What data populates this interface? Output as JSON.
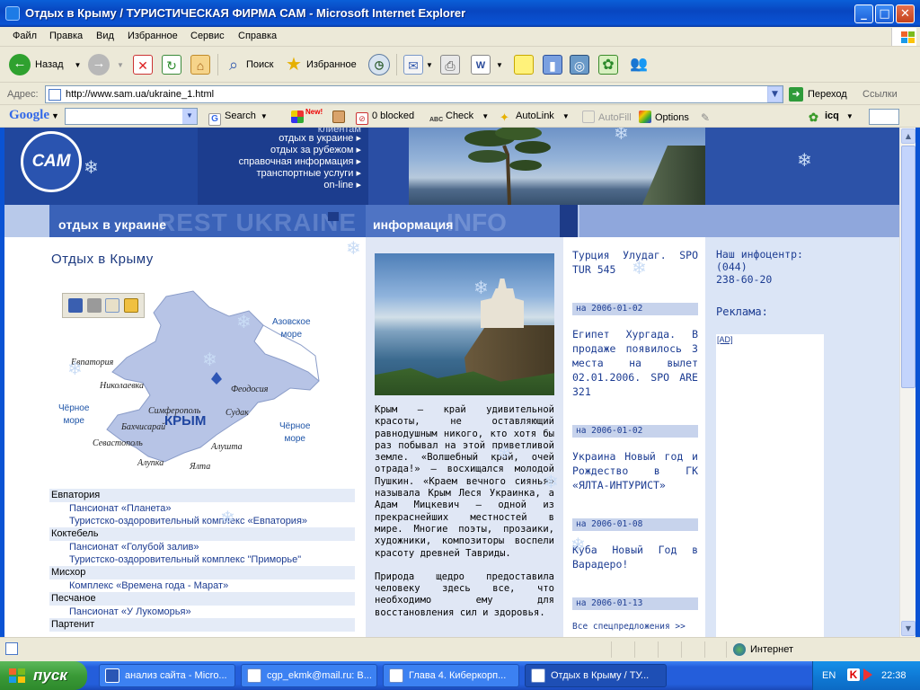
{
  "window": {
    "title": "Отдых в Крыму / ТУРИСТИЧЕСКАЯ ФИРМА САМ - Microsoft Internet Explorer",
    "accent": "#0a53d4"
  },
  "menu": [
    "Файл",
    "Правка",
    "Вид",
    "Избранное",
    "Сервис",
    "Справка"
  ],
  "toolbar": {
    "back_label": "Назад",
    "search_label": "Поиск",
    "favorites_label": "Избранное"
  },
  "address": {
    "label": "Адрес:",
    "url": "http://www.sam.ua/ukraine_1.html",
    "go_label": "Переход",
    "links_label": "Ссылки"
  },
  "google_toolbar": {
    "logo": "Google",
    "search_label": "Search",
    "new_badge": "New!",
    "blocked_label": "0 blocked",
    "check_label": "Check",
    "autolink_label": "AutoLink",
    "autofill_label": "AutoFill",
    "options_label": "Options",
    "icq_label": "icq"
  },
  "site": {
    "logo": "САМ",
    "nav": [
      "клиентам",
      "отдых в украине",
      "отдых за рубежом",
      "справочная информация",
      "транспортные услуги",
      "on-line"
    ],
    "section_left": "отдых в украине",
    "section_left_ghost": "REST UKRAINE",
    "section_mid": "информация",
    "section_mid_ghost": "INFO",
    "page_title": "Отдых в Крыму",
    "map": {
      "region": "КРЫМ",
      "seas": [
        {
          "name": "Азовское\nморе"
        },
        {
          "name": "Чёрное\nморе"
        },
        {
          "name": "Чёрное\nморе"
        }
      ],
      "cities": [
        "Евпатория",
        "Николаевка",
        "Симферополь",
        "Бахчисарай",
        "Севастополь",
        "Алупка",
        "Ялта",
        "Алушта",
        "Судак",
        "Феодосия"
      ]
    },
    "locations": [
      {
        "name": "Евпатория",
        "items": [
          "Пансионат «Планета»",
          "Туристско-оздоровительный комплекс «Евпатория»"
        ]
      },
      {
        "name": "Коктебель",
        "items": [
          "Пансионат «Голубой залив»",
          "Туристско-оздоровительный комплекс \"Приморье\""
        ]
      },
      {
        "name": "Мисхор",
        "items": [
          "Комплекс «Времена года - Марат»"
        ]
      },
      {
        "name": "Песчаное",
        "items": [
          "Пансионат «У Лукоморья»"
        ]
      },
      {
        "name": "Партенит",
        "items": []
      }
    ],
    "info_paragraphs": [
      "Крым – край удивительной красоты, не оставляющий равнодушным никого, кто хотя бы раз побывал на этой приветливой земле. «Волшебный край, очей отрада!» – восхищался молодой Пушкин. «Краем вечного сиянья» называла Крым Леся Украинка, а Адам Мицкевич – одной из прекраснейших местностей в мире. Многие поэты, прозаики, художники, композиторы воспели красоту древней Тавриды.",
      "Природа щедро предоставила человеку здесь все, что необходимо ему для восстановления сил и здоровья."
    ],
    "news": [
      {
        "text": "Турция Улудаг. SPO TUR 545",
        "date": "на 2006-01-02"
      },
      {
        "text": "Египет Хургада. В продаже появилось 3 места на вылет 02.01.2006. SPO ARE 321",
        "date": "на 2006-01-02"
      },
      {
        "text": "Украина Новый год и Рождество в ГК «ЯЛТА-ИНТУРИСТ»",
        "date": "на 2006-01-08"
      },
      {
        "text": "Куба Новый Год в Варадеро!",
        "date": "на 2006-01-13"
      }
    ],
    "all_special": "Все спецпредложения >>",
    "infocenter": "Наш инфоцентр:\n(044)\n238-60-20",
    "ads_label": "Реклама:",
    "ad_link": "[AD]"
  },
  "status": {
    "zone": "Интернет"
  },
  "taskbar": {
    "start": "пуск",
    "tasks": [
      "анализ сайта - Micro...",
      "cgp_ekmk@mail.ru: В...",
      "Глава 4. Киберкорп...",
      "Отдых в Крыму / ТУ..."
    ],
    "lang": "EN",
    "clock": "22:38"
  }
}
